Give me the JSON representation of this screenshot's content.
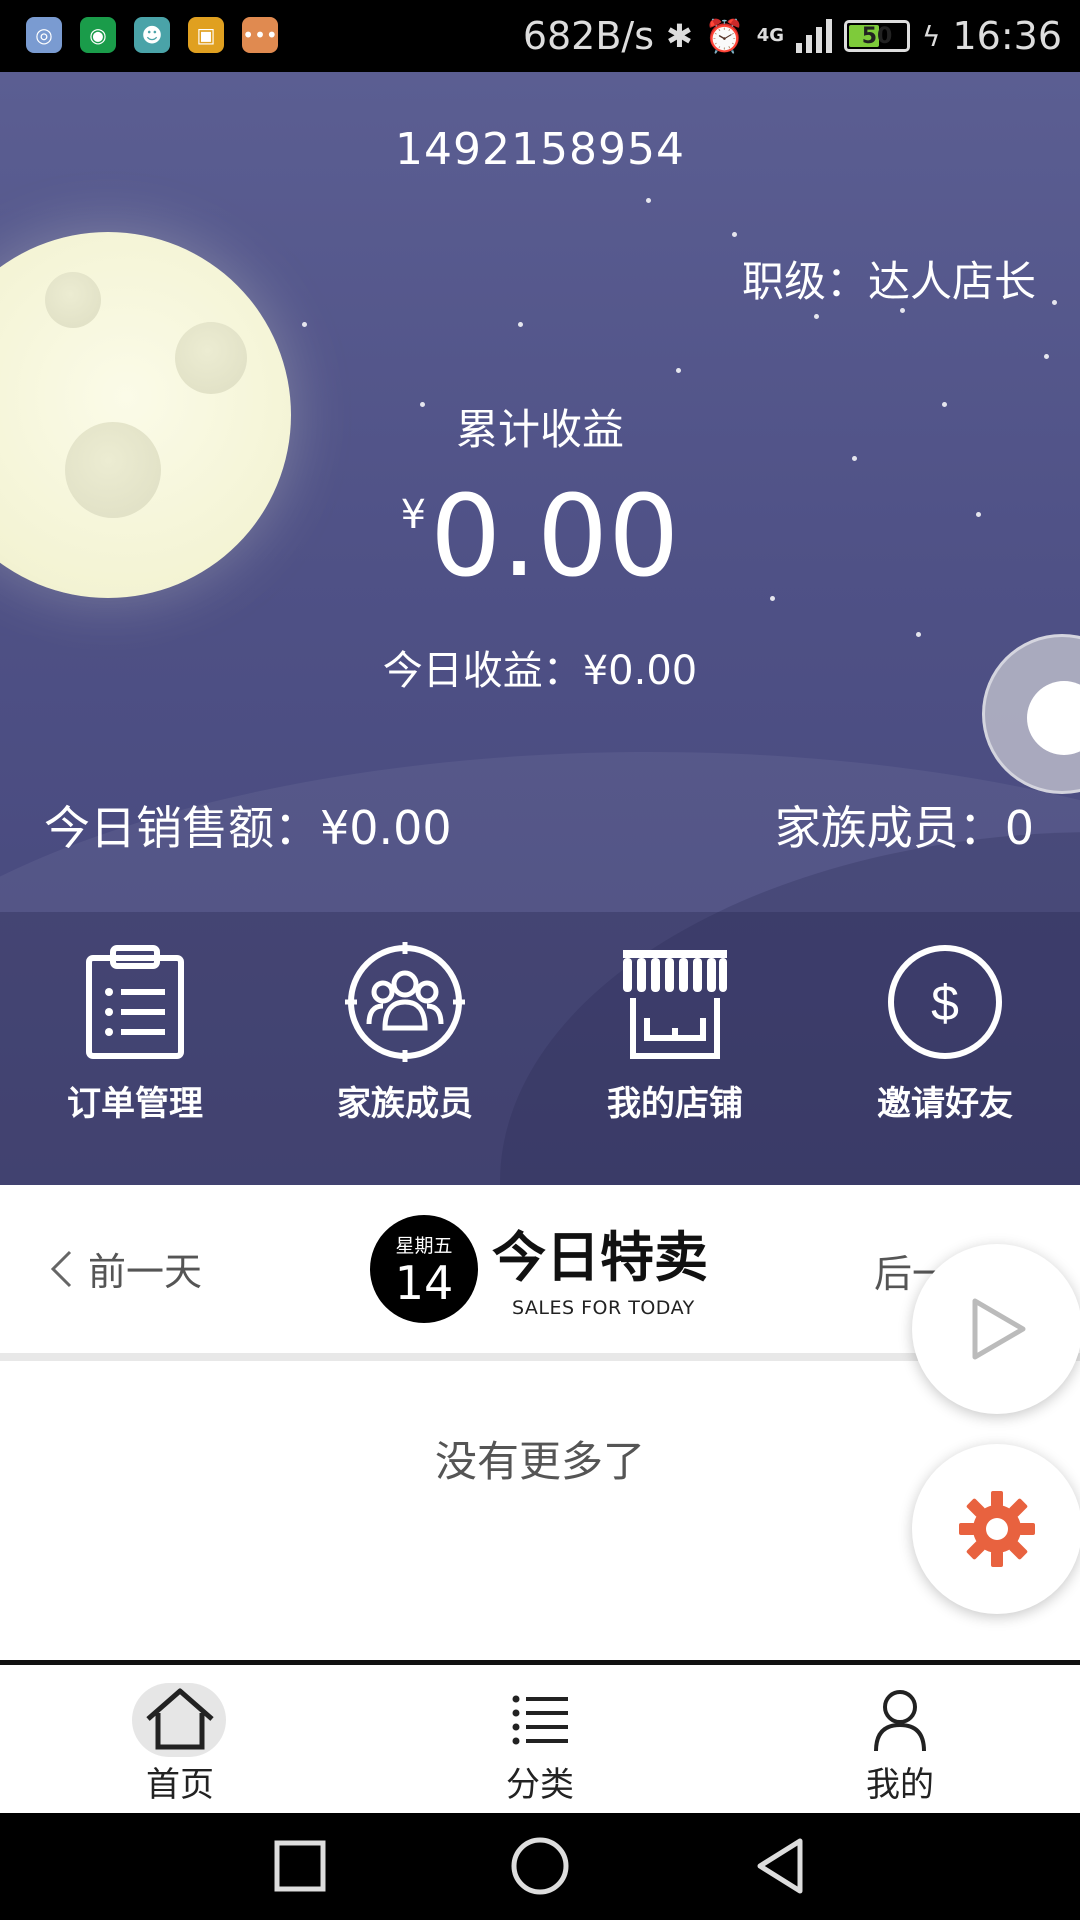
{
  "status_bar": {
    "net_speed": "682B/s",
    "battery": "50",
    "time": "16:36",
    "network": "4G"
  },
  "hero": {
    "account_id": "1492158954",
    "rank": "职级：达人店长",
    "total_label": "累计收益",
    "currency_symbol": "¥",
    "total_value": "0.00",
    "today_earnings": "今日收益：¥0.00",
    "sales_today": "今日销售额：¥0.00",
    "family_members": "家族成员：0"
  },
  "menu": [
    {
      "label": "订单管理",
      "icon": "clipboard-icon"
    },
    {
      "label": "家族成员",
      "icon": "group-icon"
    },
    {
      "label": "我的店铺",
      "icon": "store-icon"
    },
    {
      "label": "邀请好友",
      "icon": "dollar-icon"
    }
  ],
  "date_bar": {
    "prev": "前一天",
    "weekday": "星期五",
    "day": "14",
    "title": "今日特卖",
    "subtitle": "SALES FOR TODAY",
    "next": "后一"
  },
  "list": {
    "empty_text": "没有更多了"
  },
  "bottom_nav": [
    {
      "label": "首页",
      "icon": "home-icon",
      "active": true
    },
    {
      "label": "分类",
      "icon": "list-icon",
      "active": false
    },
    {
      "label": "我的",
      "icon": "user-icon",
      "active": false
    }
  ],
  "colors": {
    "hero_top": "#5b5e92",
    "hero_bottom": "#45467a",
    "gear": "#e8623f"
  }
}
